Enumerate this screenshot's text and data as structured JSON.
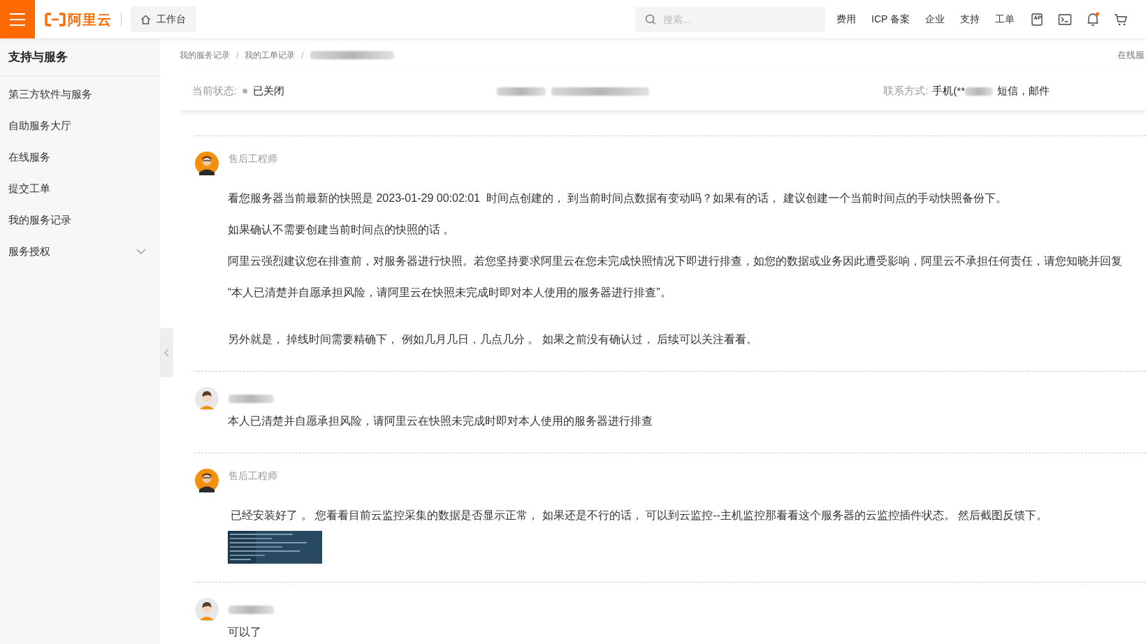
{
  "topbar": {
    "logo_text": "阿里云",
    "workbench": "工作台",
    "search_placeholder": "搜索...",
    "nav": [
      "费用",
      "ICP 备案",
      "企业",
      "支持",
      "工单"
    ],
    "notification_dot": true
  },
  "sidebar": {
    "title": "支持与服务",
    "items": [
      {
        "label": "第三方软件与服务"
      },
      {
        "label": "自助服务大厅"
      },
      {
        "label": "在线服务"
      },
      {
        "label": "提交工单"
      },
      {
        "label": "我的服务记录"
      },
      {
        "label": "服务授权",
        "expanded": false
      }
    ]
  },
  "breadcrumb": [
    "我的服务记录",
    "我的工单记录"
  ],
  "breadcrumb_separator": "/",
  "online_link": "在线服",
  "ticket": {
    "status_label": "当前状态:",
    "status": "已关闭",
    "status_active": false,
    "contact_label": "联系方式:",
    "contact_prefix": "手机(**",
    "contact_suffix": "短信，邮件"
  },
  "messages": [
    {
      "kind": "engineer",
      "author": "售后工程师",
      "paragraphs": [
        "看您服务器当前最新的快照是 2023-01-29 00:02:01  时间点创建的， 到当前时间点数据有变动吗？如果有的话， 建议创建一个当前时间点的手动快照备份下。",
        "如果确认不需要创建当前时间点的快照的话 。",
        "阿里云强烈建议您在排查前，对服务器进行快照。若您坚持要求阿里云在您未完成快照情况下即进行排查，如您的数据或业务因此遭受影响，阿里云不承担任何责任，请您知晓并回复",
        "“本人已清楚并自愿承担风险，请阿里云在快照未完成时即对本人使用的服务器进行排查”。",
        "另外就是， 掉线时间需要精确下， 例如几月几日，几点几分 。 如果之前没有确认过， 后续可以关注看看。"
      ]
    },
    {
      "kind": "customer",
      "paragraphs": [
        "本人已清楚并自愿承担风险，请阿里云在快照未完成时即对本人使用的服务器进行排查"
      ]
    },
    {
      "kind": "engineer",
      "author": "售后工程师",
      "paragraphs": [
        " 已经安装好了 。 您看看目前云监控采集的数据是否显示正常， 如果还是不行的话， 可以到云监控--主机监控那看看这个服务器的云监控插件状态。 然后截图反馈下。"
      ],
      "attachment": true
    },
    {
      "kind": "customer",
      "paragraphs": [
        "可以了"
      ]
    }
  ]
}
